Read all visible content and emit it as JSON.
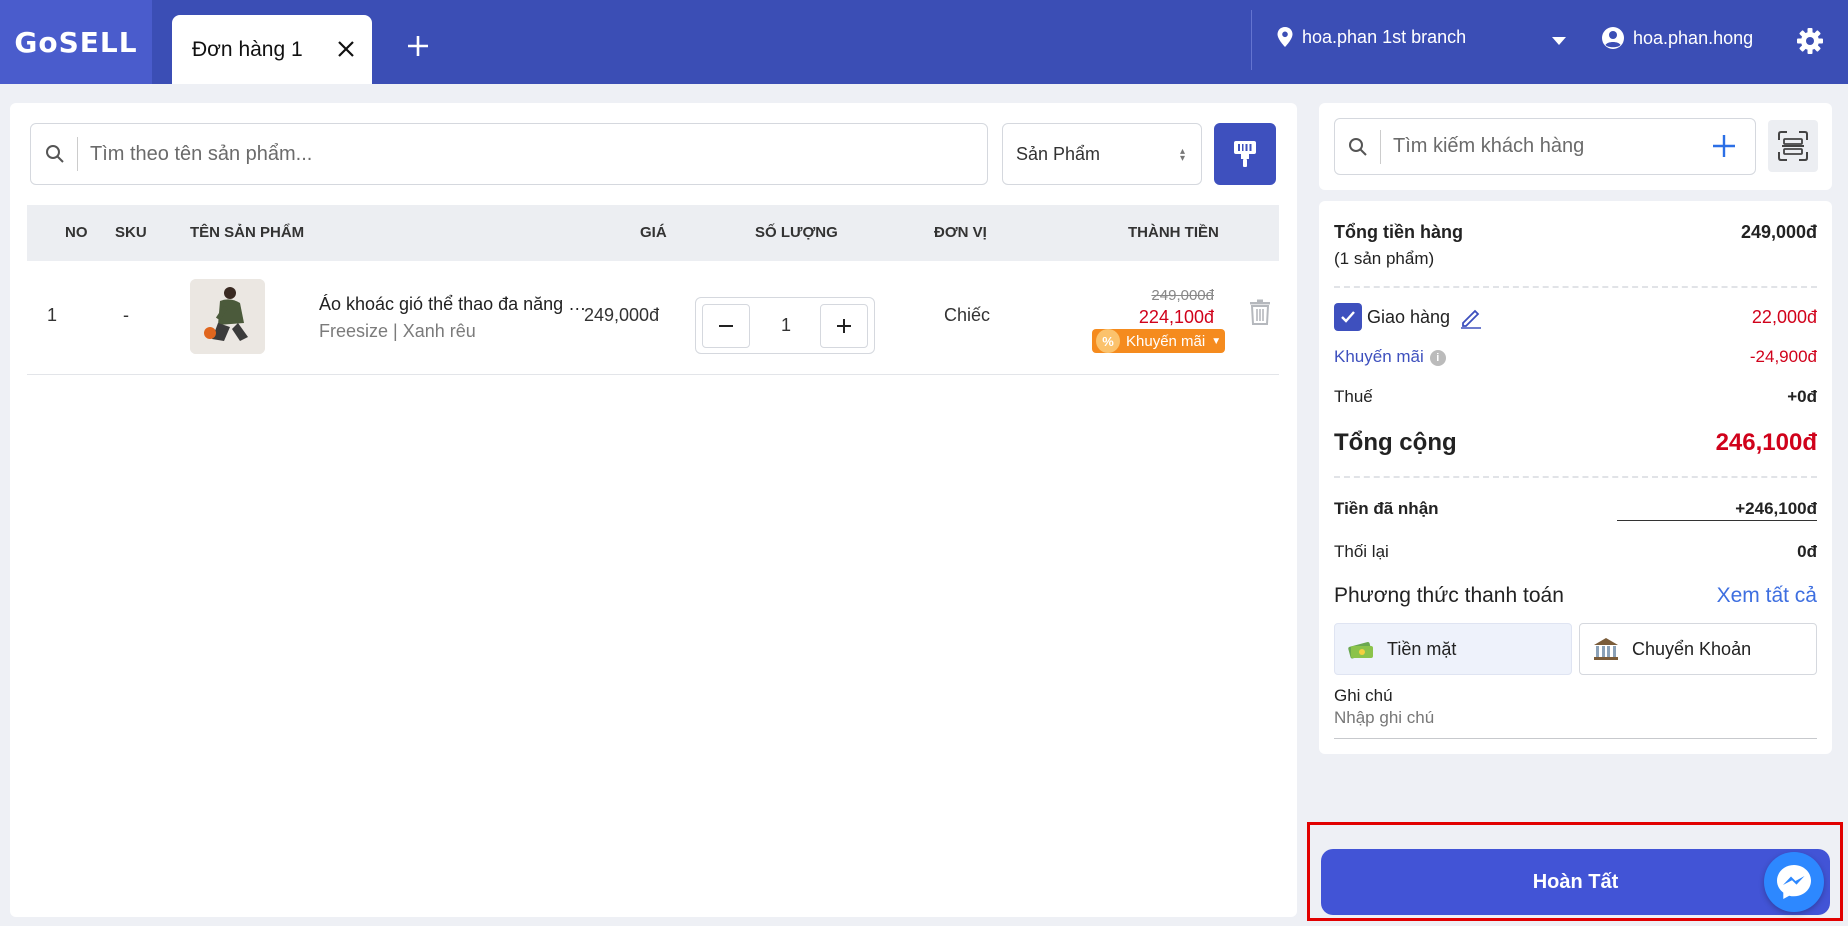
{
  "header": {
    "logo": "GoSELL",
    "tabs": [
      {
        "label": "Đơn hàng 1"
      }
    ],
    "branch": "hoa.phan 1st branch",
    "user": "hoa.phan.hong"
  },
  "product_search": {
    "placeholder": "Tìm theo tên sản phẩm...",
    "type_selected": "Sản Phẩm"
  },
  "table": {
    "headers": {
      "no": "NO",
      "sku": "SKU",
      "name": "TÊN SẢN PHẨM",
      "price": "GIÁ",
      "quantity": "SỐ LƯỢNG",
      "unit": "ĐƠN VỊ",
      "total": "THÀNH TIỀN"
    },
    "rows": [
      {
        "no": "1",
        "sku": "-",
        "name": "Áo khoác gió thể thao đa năng cả...",
        "variant": "Freesize | Xanh rêu",
        "price": "249,000đ",
        "quantity": "1",
        "unit": "Chiếc",
        "old_total": "249,000đ",
        "total": "224,100đ",
        "promo_label": "Khuyến mãi",
        "promo_icon": "%"
      }
    ]
  },
  "customer": {
    "placeholder": "Tìm kiếm khách hàng"
  },
  "summary": {
    "subtotal_label": "Tổng tiền hàng",
    "subtotal_count": "(1 sản phẩm)",
    "subtotal_value": "249,000đ",
    "shipping_label": "Giao hàng",
    "shipping_value": "22,000đ",
    "promotion_label": "Khuyến mãi",
    "promotion_value": "-24,900đ",
    "tax_label": "Thuế",
    "tax_value": "+0đ",
    "total_label": "Tổng cộng",
    "total_value": "246,100đ",
    "received_label": "Tiền đã nhận",
    "received_value": "+246,100đ",
    "change_label": "Thối lại",
    "change_value": "0đ",
    "payment_label": "Phương thức thanh toán",
    "view_all": "Xem tất cả",
    "payment_methods": [
      {
        "label": "Tiền mặt"
      },
      {
        "label": "Chuyển Khoản"
      }
    ],
    "note_label": "Ghi chú",
    "note_placeholder": "Nhập ghi chú"
  },
  "complete_button": "Hoàn Tất",
  "colors": {
    "primary": "#3b4eb5",
    "button": "#4254d6",
    "price_red": "#d0021b",
    "promo_orange": "#f58b1e",
    "highlight_border": "#e10000"
  }
}
